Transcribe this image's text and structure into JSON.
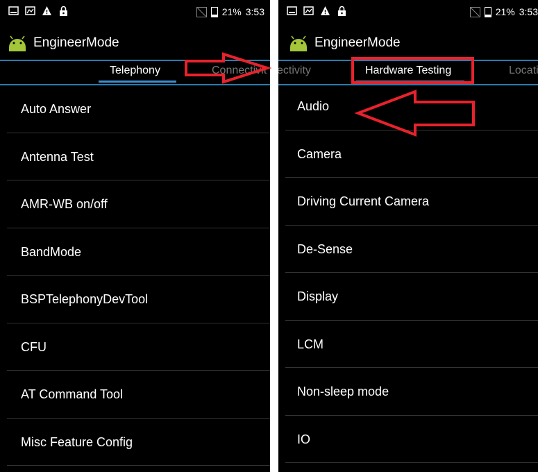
{
  "left": {
    "status": {
      "battery": "21%",
      "time": "3:53"
    },
    "app_title": "EngineerMode",
    "tabs": {
      "active": "Telephony",
      "next": "Connectivit"
    },
    "items": [
      "Auto Answer",
      "Antenna Test",
      "AMR-WB on/off",
      "BandMode",
      "BSPTelephonyDevTool",
      "CFU",
      "AT Command Tool",
      "Misc Feature Config"
    ]
  },
  "right": {
    "status": {
      "battery": "21%",
      "time": "3:53"
    },
    "app_title": "EngineerMode",
    "tabs": {
      "prev": "ectivity",
      "active": "Hardware Testing",
      "next": "Locati"
    },
    "items": [
      "Audio",
      "Camera",
      "Driving Current Camera",
      "De-Sense",
      "Display",
      "LCM",
      "Non-sleep mode",
      "IO"
    ]
  },
  "colors": {
    "accent_blue": "#2a7bb0",
    "annotation_red": "#e8222c",
    "android_green": "#a4c639"
  },
  "icons": [
    "notification-icon",
    "screenshot-icon",
    "warning-icon",
    "lock-icon",
    "no-sim-icon",
    "battery-icon",
    "android-logo-icon",
    "arrow-right-annotation",
    "arrow-left-annotation"
  ]
}
